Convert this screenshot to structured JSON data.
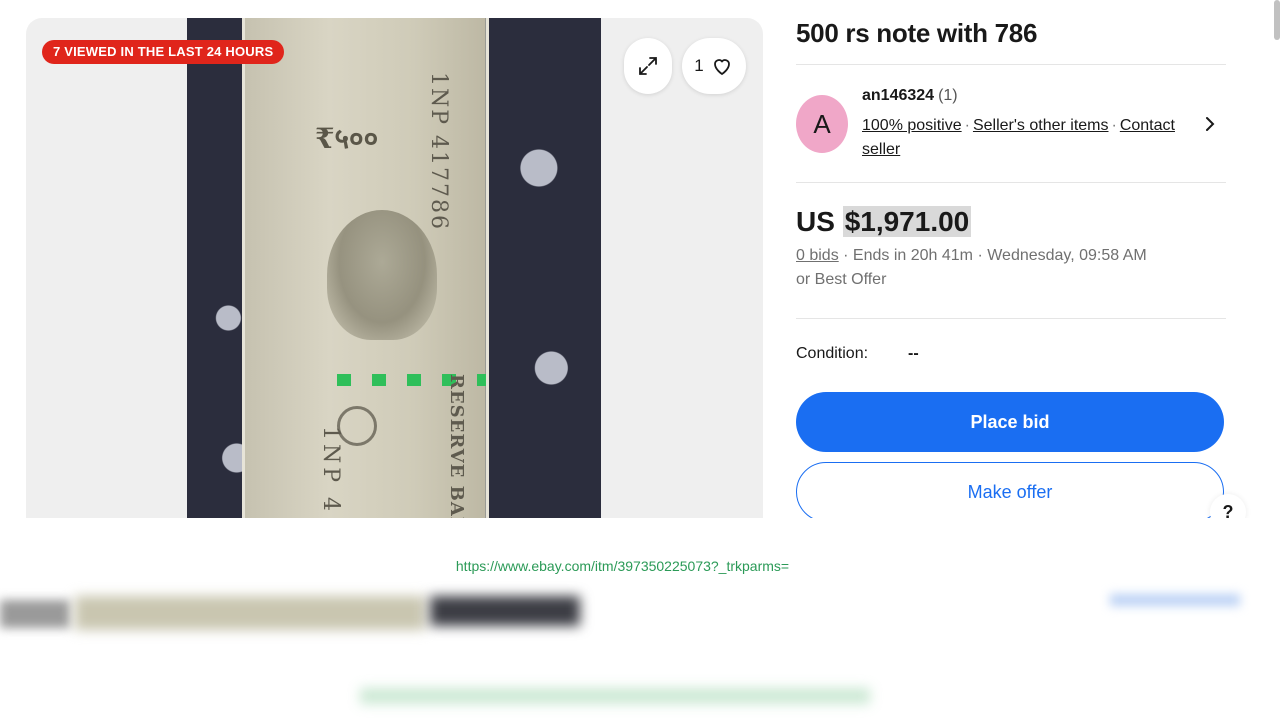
{
  "gallery": {
    "badge": "7 VIEWED IN THE LAST 24 HOURS",
    "watch_count": "1",
    "note_serial": "1NP 417786",
    "note_denomination": "₹५००",
    "note_bank": "RESERVE BANK",
    "note_prefix": "1NP 4"
  },
  "listing": {
    "title": "500 rs note with 786",
    "price_currency": "US",
    "price_value": "$1,971.00",
    "bids": "0 bids",
    "ends": "· Ends in 20h 41m · Wednesday, 09:58 AM",
    "or_best_offer": "or Best Offer",
    "condition_label": "Condition:",
    "condition_value": "--"
  },
  "seller": {
    "avatar_letter": "A",
    "name": "an146324",
    "score": "(1)",
    "positive": "100% positive",
    "other_items": "Seller's other items",
    "contact": "Contact seller"
  },
  "actions": {
    "place_bid": "Place bid",
    "make_offer": "Make offer",
    "help": "?"
  },
  "footer": {
    "url": "https://www.ebay.com/itm/397350225073?_trkparms="
  },
  "colors": {
    "accent": "#1a6ef2",
    "badge": "#e0251b",
    "avatar": "#f0a7c8",
    "url": "#2b9a57"
  }
}
